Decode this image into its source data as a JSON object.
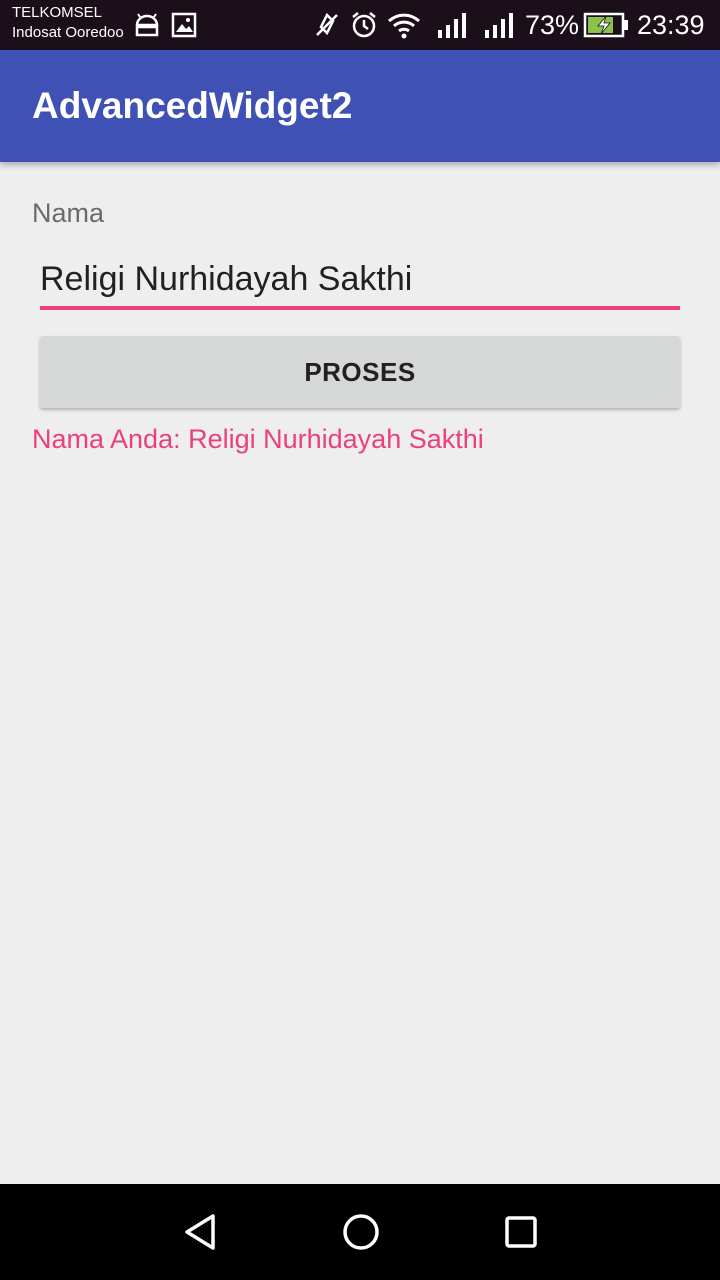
{
  "status_bar": {
    "carrier_1": "TELKOMSEL",
    "carrier_2": "Indosat Ooredoo",
    "battery_percent": "73%",
    "time": "23:39",
    "icons": [
      "android-debug-icon",
      "image-notification-icon",
      "vibrate-off-icon",
      "alarm-icon",
      "wifi-icon",
      "signal-icon",
      "signal-icon",
      "battery-charging-icon"
    ]
  },
  "app_bar": {
    "title": "AdvancedWidget2",
    "color": "#3f51b5"
  },
  "form": {
    "name_label": "Nama",
    "name_value": "Religi Nurhidayah Sakthi",
    "submit_label": "PROSES",
    "result_text": "Nama Anda: Religi Nurhidayah Sakthi",
    "accent_color": "#ec407a"
  },
  "nav_bar": {
    "icons": [
      "back-icon",
      "home-icon",
      "recents-icon"
    ]
  }
}
